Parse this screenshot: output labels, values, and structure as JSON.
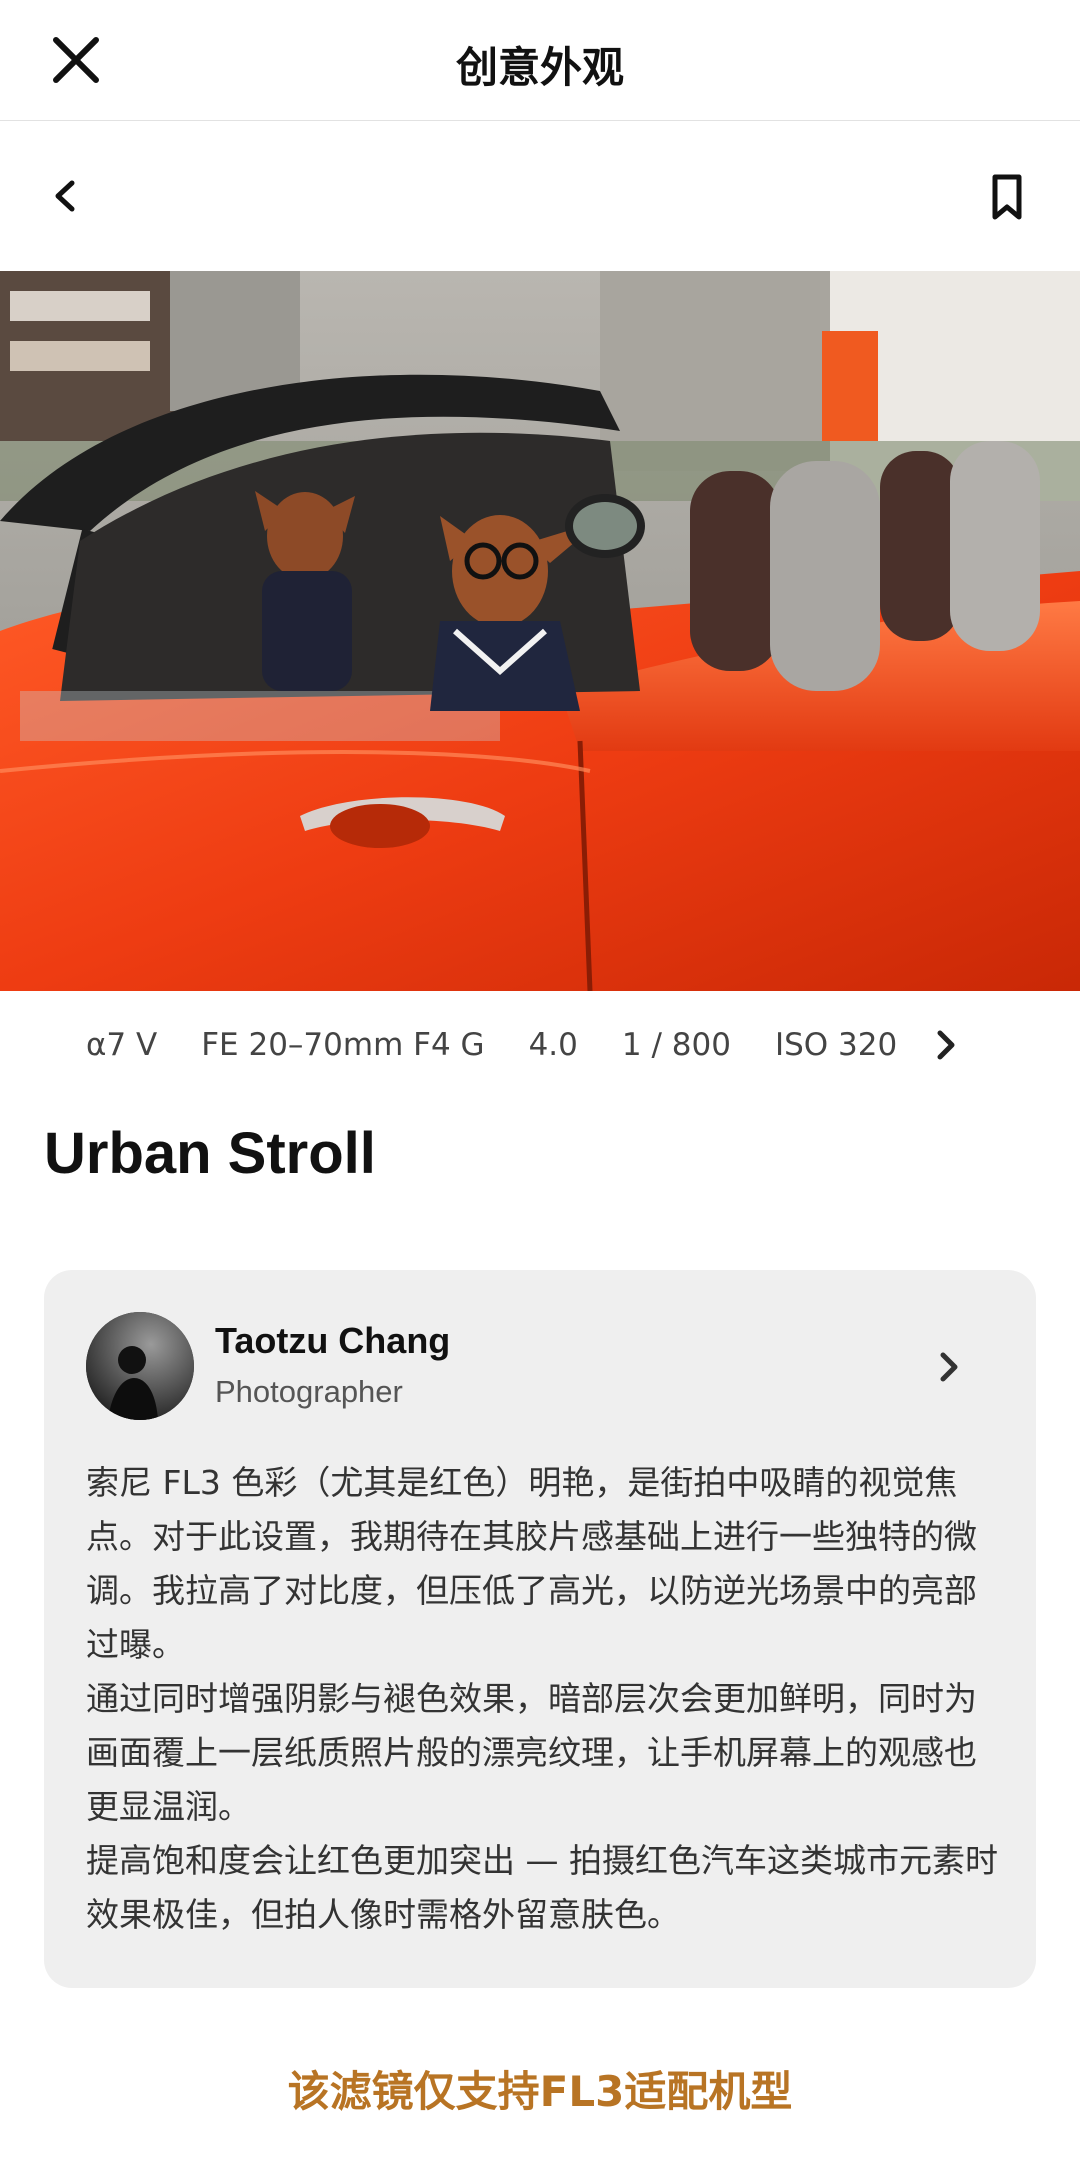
{
  "header": {
    "title": "创意外观",
    "close_icon": "close-icon"
  },
  "nav": {
    "back_icon": "chevron-left-icon",
    "bookmark_icon": "bookmark-icon"
  },
  "photo": {
    "subject": ""
  },
  "specs": {
    "items": [
      "α7 V",
      "FE 20–70mm F4 G",
      "4.0",
      "1 / 800",
      "ISO 320"
    ],
    "more_icon": "chevron-right-icon"
  },
  "style": {
    "title": "Urban Stroll"
  },
  "author": {
    "name": "Taotzu Chang",
    "role": "Photographer",
    "chevron_icon": "chevron-right-icon"
  },
  "description": "索尼 FL3 色彩（尤其是红色）明艳，是街拍中吸睛的视觉焦点。对于此设置，我期待在其胶片感基础上进行一些独特的微调。我拉高了对比度，但压低了高光，以防逆光场景中的亮部过曝。\n通过同时增强阴影与褪色效果，暗部层次会更加鲜明，同时为画面覆上一层纸质照片般的漂亮纹理，让手机屏幕上的观感也更显温润。\n提高饱和度会让红色更加突出 — 拍摄红色汽车这类城市元素时效果极佳，但拍人像时需格外留意肤色。",
  "footer": {
    "note": "该滤镜仅支持FL3适配机型"
  },
  "colors": {
    "accent": "#b87424",
    "card_bg": "#efefef",
    "car_red": "#f0401a"
  }
}
